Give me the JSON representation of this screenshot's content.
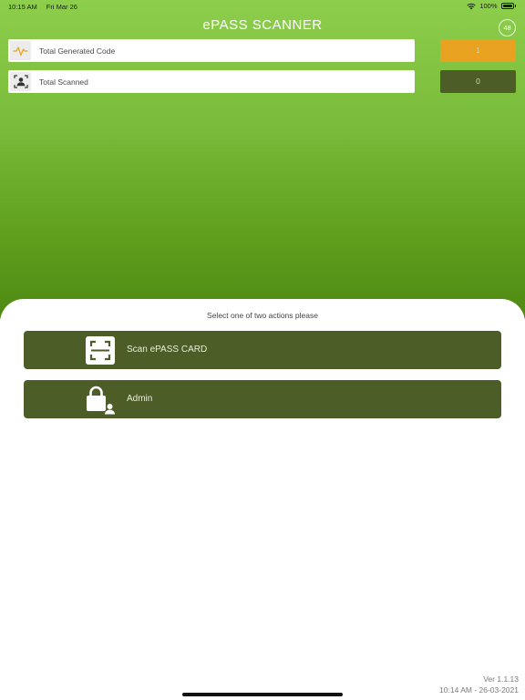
{
  "status_bar": {
    "time": "10:15 AM",
    "date": "Fri Mar 26",
    "battery": "100%"
  },
  "header": {
    "title": "ePASS SCANNER",
    "badge": "48"
  },
  "stats": [
    {
      "label": "Total Generated Code",
      "value": "1",
      "icon": "pulse-icon",
      "color": "#e8a21f"
    },
    {
      "label": "Total Scanned",
      "value": "0",
      "icon": "face-scan-icon",
      "color": "#4d5d28"
    }
  ],
  "sheet": {
    "prompt": "Select one of two actions please",
    "actions": [
      {
        "label": "Scan ePASS CARD",
        "icon": "scan-frame-icon"
      },
      {
        "label": "Admin",
        "icon": "lock-user-icon"
      }
    ]
  },
  "footer": {
    "version": "Ver 1.1.13",
    "timestamp": "10:14 AM - 26-03-2021"
  },
  "colors": {
    "accent_orange": "#e8a21f",
    "dark_olive": "#4d5d28",
    "green_top": "#8dcf4c",
    "green_bottom": "#4f8a14"
  }
}
